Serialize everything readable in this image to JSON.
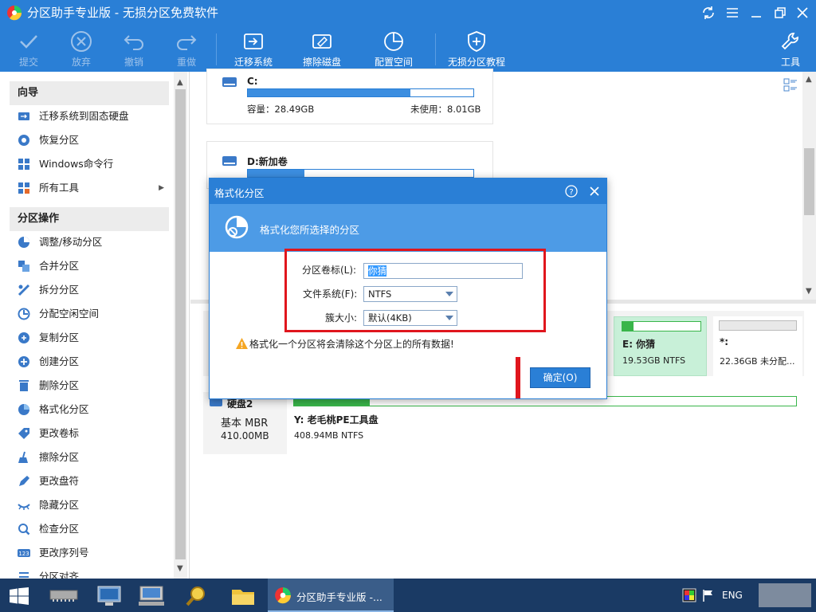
{
  "window": {
    "title": "分区助手专业版 - 无损分区免费软件"
  },
  "toolbar": {
    "submit": "提交",
    "discard": "放弃",
    "undo": "撤销",
    "redo": "重做",
    "migrate": "迁移系统",
    "wipe": "擦除磁盘",
    "allocate": "配置空间",
    "tutorial": "无损分区教程",
    "tools": "工具"
  },
  "sidebar": {
    "wizard_title": "向导",
    "wizard_items": [
      "迁移系统到固态硬盘",
      "恢复分区",
      "Windows命令行",
      "所有工具"
    ],
    "ops_title": "分区操作",
    "ops_items": [
      "调整/移动分区",
      "合并分区",
      "拆分分区",
      "分配空闲空间",
      "复制分区",
      "创建分区",
      "删除分区",
      "格式化分区",
      "更改卷标",
      "擦除分区",
      "更改盘符",
      "隐藏分区",
      "检查分区",
      "更改序列号",
      "分区对齐"
    ]
  },
  "partitions": {
    "c": {
      "name": "C:",
      "capacity": "容量：28.49GB",
      "unused": "未使用：8.01GB",
      "used_fraction": 0.72
    },
    "d": {
      "name": "D:新加卷",
      "used_fraction": 0.25
    }
  },
  "disk_map": {
    "e": {
      "name": "E: 你猜",
      "info": "19.53GB NTFS"
    },
    "unalloc": {
      "name": "*:",
      "info": "22.36GB 未分配..."
    },
    "disk2": {
      "name": "硬盘2",
      "type": "基本 MBR",
      "size": "410.00MB"
    },
    "y": {
      "name": "Y: 老毛桃PE工具盘",
      "info": "408.94MB NTFS"
    }
  },
  "dialog": {
    "title": "格式化分区",
    "banner": "格式化您所选择的分区",
    "label_volume": "分区卷标(L):",
    "volume_value": "你猜",
    "label_fs": "文件系统(F):",
    "fs_value": "NTFS",
    "label_cluster": "簇大小:",
    "cluster_value": "默认(4KB)",
    "warning": "格式化一个分区将会清除这个分区上的所有数据!",
    "ok_label": "确定(O)"
  },
  "taskbar": {
    "active_app": "分区助手专业版 -...",
    "lang": "ENG"
  },
  "colors": {
    "accent": "#2a7fd6",
    "banner": "#4d9be6",
    "highlight": "#e0161d",
    "selected_partition": "#c8f0d8"
  }
}
